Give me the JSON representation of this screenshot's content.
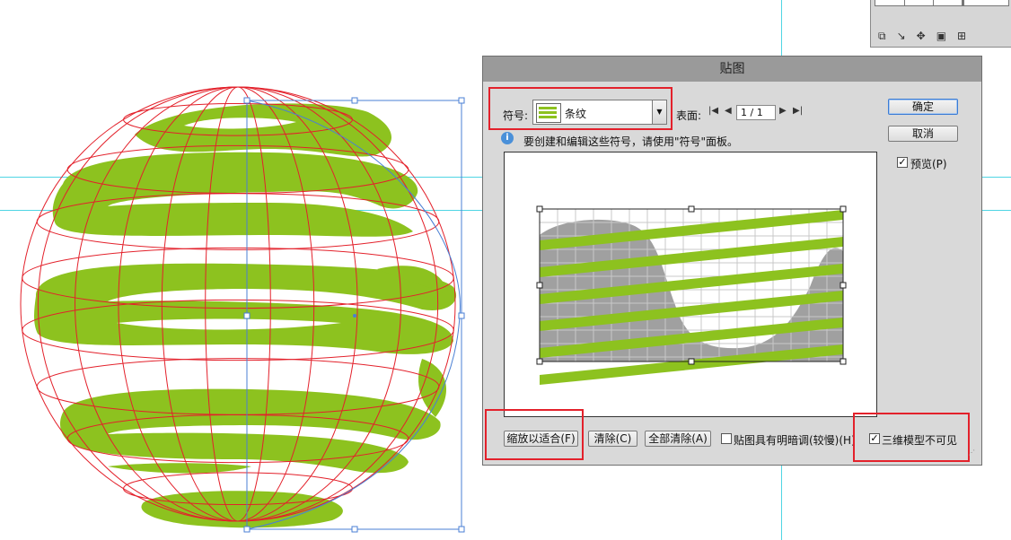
{
  "dialog": {
    "title": "贴图",
    "symbol_label": "符号:",
    "symbol_value": "条纹",
    "surface_label": "表面:",
    "surface_value": "1 / 1",
    "info_text": "要创建和编辑这些符号，请使用\"符号\"面板。",
    "ok_label": "确定",
    "cancel_label": "取消",
    "preview_label": "预览(P)",
    "preview_checked": true,
    "scale_to_fit_label": "缩放以适合(F)",
    "clear_label": "清除(C)",
    "clear_all_label": "全部清除(A)",
    "shade_artwork_label": "贴图具有明暗调(较慢)(H)",
    "shade_artwork_checked": false,
    "invisible_geometry_label": "三维模型不可见",
    "invisible_geometry_checked": true
  },
  "colors": {
    "stripe_green": "#8dc21f",
    "wireframe_red": "#e3212b",
    "highlight_red": "#e3212b",
    "guide_cyan": "#4fd5e4",
    "surface_gray": "#a0a0a0",
    "selection_blue": "#4a7fd4"
  },
  "icons": {
    "info": "info-icon",
    "first": "first-page-icon",
    "prev": "prev-page-icon",
    "next": "next-page-icon",
    "last": "last-page-icon",
    "dropdown": "chevron-down-icon"
  }
}
